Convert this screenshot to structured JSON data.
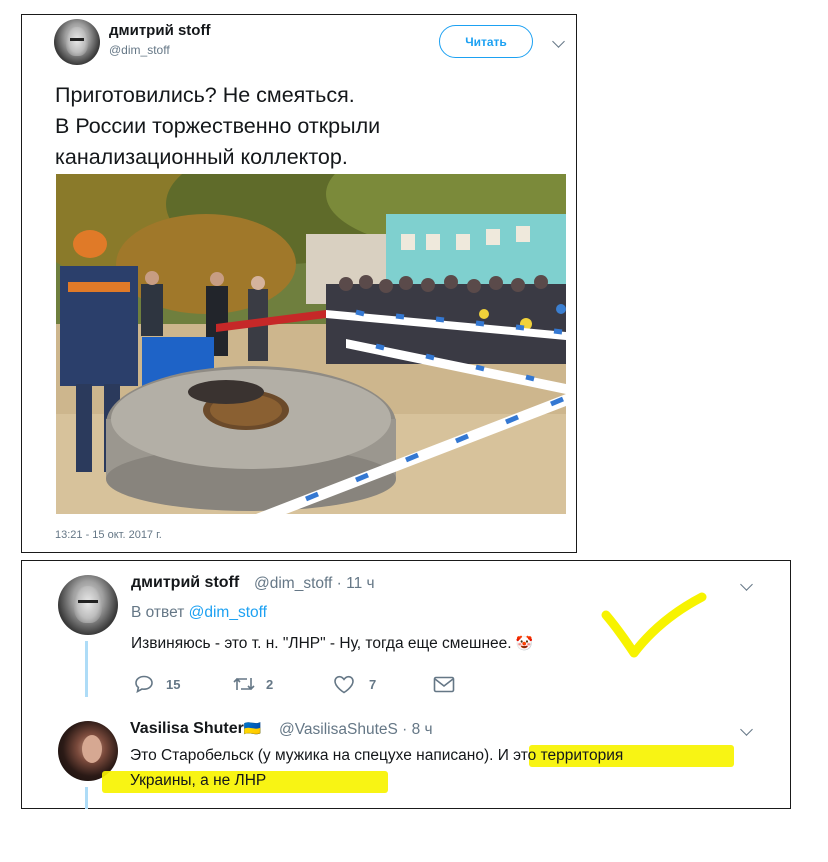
{
  "tweet": {
    "author_name": "дмитрий stoff",
    "author_handle": "@dim_stoff",
    "follow_label": "Читать",
    "text_lines": [
      "Приготовились? Не смеяться.",
      "В России торжественно открыли",
      "канализационный коллектор."
    ],
    "timestamp": "13:21 - 15 окт. 2017 г."
  },
  "reply1": {
    "author_name": "дмитрий stoff",
    "author_handle": "@dim_stoff",
    "time": "11 ч",
    "in_reply_prefix": "В ответ",
    "in_reply_handle": "@dim_stoff",
    "text": "Извиняюсь - это т. н. \"ЛНР\" - Ну, тогда еще смешнее.",
    "emoji": "🤡",
    "reply_count": "15",
    "retweet_count": "2",
    "like_count": "7"
  },
  "reply2": {
    "author_name": "Vasilisa Shuter",
    "flag": "🇺🇦",
    "author_handle": "@VasilisaShuteS",
    "time": "8 ч",
    "text_line1": "Это Старобельск (у мужика на спецухе написано). И это территория",
    "text_line2": "Украины, а не ЛНР"
  },
  "colors": {
    "accent": "#1da1f2",
    "muted": "#657786",
    "highlight": "#f7f300",
    "reply_thread": "#aedcf7"
  },
  "icons": [
    "chevron-down-icon",
    "reply-icon",
    "retweet-icon",
    "like-icon",
    "message-icon",
    "checkmark-annotation"
  ]
}
